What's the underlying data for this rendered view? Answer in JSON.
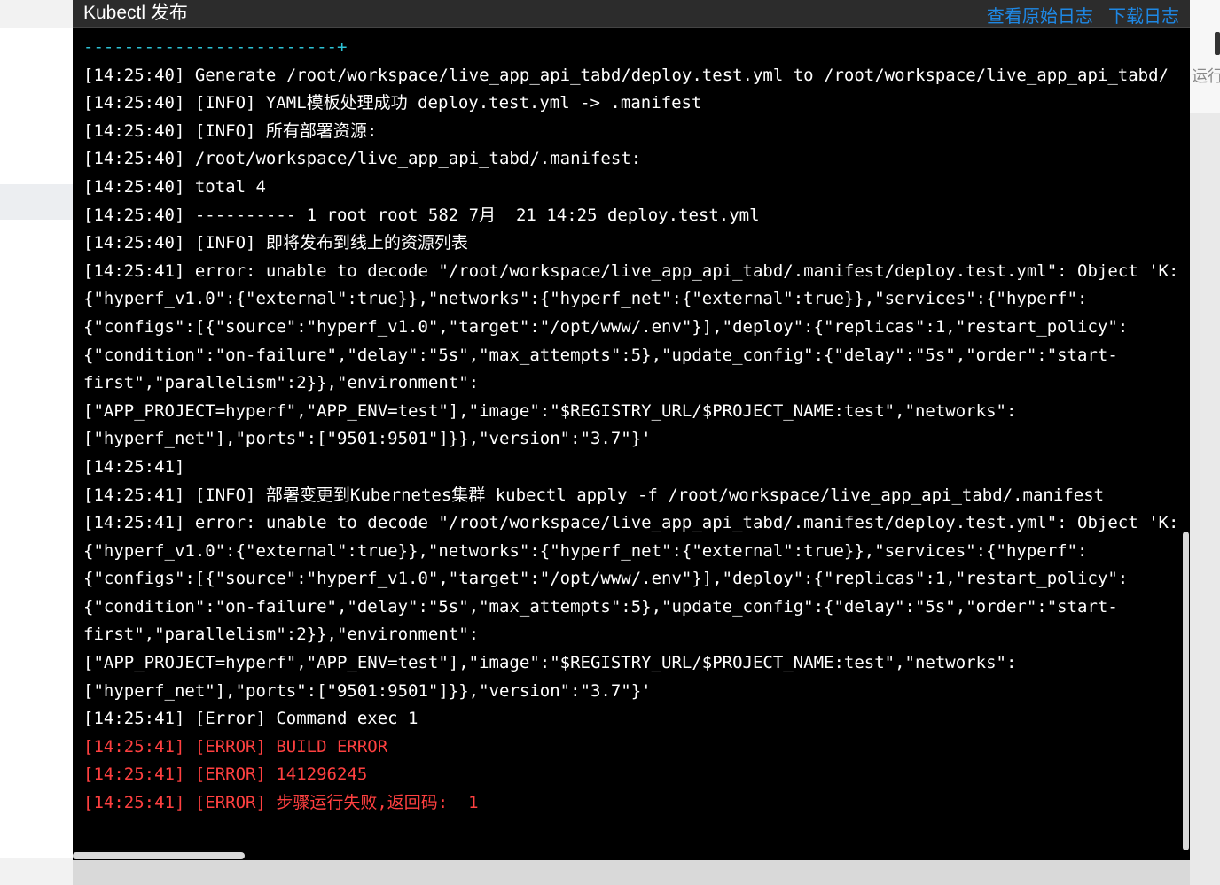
{
  "modal": {
    "title": "Kubectl 发布",
    "view_raw_label": "查看原始日志",
    "download_label": "下载日志"
  },
  "background": {
    "right_text": "运行"
  },
  "log": {
    "lines": [
      {
        "text": "-------------------------+",
        "kind": "sep"
      },
      {
        "text": "[14:25:40] Generate /root/workspace/live_app_api_tabd/deploy.test.yml to /root/workspace/live_app_api_tabd/",
        "kind": "normal"
      },
      {
        "text": "[14:25:40] [INFO] YAML模板处理成功 deploy.test.yml -> .manifest",
        "kind": "normal"
      },
      {
        "text": "[14:25:40] [INFO] 所有部署资源:",
        "kind": "normal"
      },
      {
        "text": "[14:25:40] /root/workspace/live_app_api_tabd/.manifest:",
        "kind": "normal"
      },
      {
        "text": "[14:25:40] total 4",
        "kind": "normal"
      },
      {
        "text": "[14:25:40] ---------- 1 root root 582 7月  21 14:25 deploy.test.yml",
        "kind": "normal"
      },
      {
        "text": "[14:25:40] [INFO] 即将发布到线上的资源列表",
        "kind": "normal"
      },
      {
        "text": "[14:25:41] error: unable to decode \"/root/workspace/live_app_api_tabd/.manifest/deploy.test.yml\": Object 'K:",
        "kind": "normal"
      },
      {
        "text": "{\"hyperf_v1.0\":{\"external\":true}},\"networks\":{\"hyperf_net\":{\"external\":true}},\"services\":{\"hyperf\":",
        "kind": "normal"
      },
      {
        "text": "{\"configs\":[{\"source\":\"hyperf_v1.0\",\"target\":\"/opt/www/.env\"}],\"deploy\":{\"replicas\":1,\"restart_policy\":",
        "kind": "normal"
      },
      {
        "text": "{\"condition\":\"on-failure\",\"delay\":\"5s\",\"max_attempts\":5},\"update_config\":{\"delay\":\"5s\",\"order\":\"start-",
        "kind": "normal"
      },
      {
        "text": "first\",\"parallelism\":2}},\"environment\":",
        "kind": "normal"
      },
      {
        "text": "[\"APP_PROJECT=hyperf\",\"APP_ENV=test\"],\"image\":\"$REGISTRY_URL/$PROJECT_NAME:test\",\"networks\":",
        "kind": "normal"
      },
      {
        "text": "[\"hyperf_net\"],\"ports\":[\"9501:9501\"]}},\"version\":\"3.7\"}'",
        "kind": "normal"
      },
      {
        "text": "[14:25:41]",
        "kind": "normal"
      },
      {
        "text": "[14:25:41] [INFO] 部署变更到Kubernetes集群 kubectl apply -f /root/workspace/live_app_api_tabd/.manifest",
        "kind": "normal"
      },
      {
        "text": "[14:25:41] error: unable to decode \"/root/workspace/live_app_api_tabd/.manifest/deploy.test.yml\": Object 'K:",
        "kind": "normal"
      },
      {
        "text": "{\"hyperf_v1.0\":{\"external\":true}},\"networks\":{\"hyperf_net\":{\"external\":true}},\"services\":{\"hyperf\":",
        "kind": "normal"
      },
      {
        "text": "{\"configs\":[{\"source\":\"hyperf_v1.0\",\"target\":\"/opt/www/.env\"}],\"deploy\":{\"replicas\":1,\"restart_policy\":",
        "kind": "normal"
      },
      {
        "text": "{\"condition\":\"on-failure\",\"delay\":\"5s\",\"max_attempts\":5},\"update_config\":{\"delay\":\"5s\",\"order\":\"start-",
        "kind": "normal"
      },
      {
        "text": "first\",\"parallelism\":2}},\"environment\":",
        "kind": "normal"
      },
      {
        "text": "[\"APP_PROJECT=hyperf\",\"APP_ENV=test\"],\"image\":\"$REGISTRY_URL/$PROJECT_NAME:test\",\"networks\":",
        "kind": "normal"
      },
      {
        "text": "[\"hyperf_net\"],\"ports\":[\"9501:9501\"]}},\"version\":\"3.7\"}'",
        "kind": "normal"
      },
      {
        "text": "[14:25:41] [Error] Command exec 1",
        "kind": "normal"
      },
      {
        "text": "[14:25:41] [ERROR] BUILD ERROR",
        "kind": "err"
      },
      {
        "text": "[14:25:41] [ERROR] 141296245",
        "kind": "err"
      },
      {
        "text": "[14:25:41] [ERROR] 步骤运行失败,返回码:  1",
        "kind": "err"
      }
    ]
  }
}
